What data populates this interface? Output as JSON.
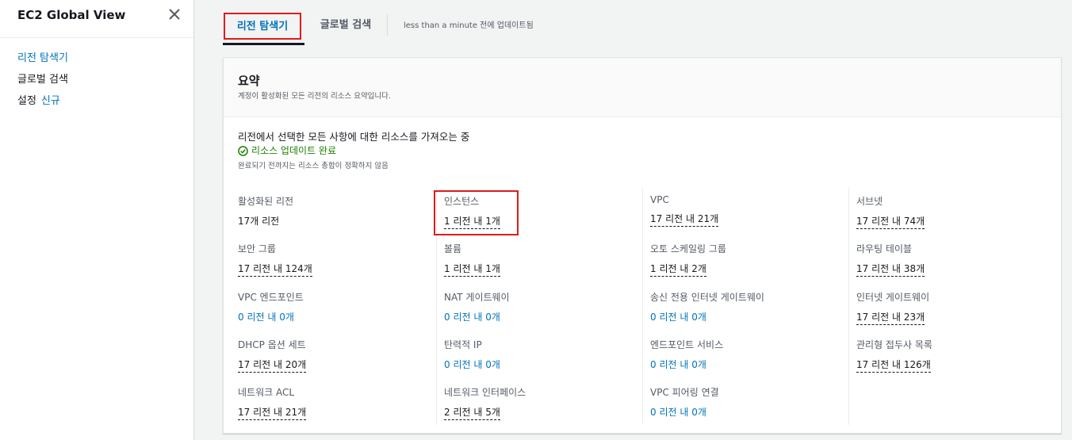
{
  "sidebar": {
    "title": "EC2 Global View",
    "items": [
      {
        "label": "리전 탐색기",
        "active": true
      },
      {
        "label": "글로벌 검색",
        "active": false
      },
      {
        "label": "설정",
        "badge": "신규",
        "active": false
      }
    ]
  },
  "tabs": {
    "region_explorer": "리전 탐색기",
    "global_search": "글로벌 검색",
    "updated": "less than a minute 전에 업데이트됨"
  },
  "summary": {
    "title": "요약",
    "subtitle": "계정이 활성화된 모든 리전의 리소스 요약입니다.",
    "status_fetching": "리전에서 선택한 모든 사항에 대한 리소스를 가져오는 중",
    "status_complete": "리소스 업데이트 완료",
    "status_note": "완료되기 전까지는 리소스 총합이 정확하지 않음",
    "columns": [
      [
        {
          "label": "활성화된 리전",
          "value": "17개 리전",
          "style": "plain"
        },
        {
          "label": "보안 그룹",
          "value": "17 리전 내 124개",
          "style": "dashed"
        },
        {
          "label": "VPC 엔드포인트",
          "value": "0 리전 내 0개",
          "style": "link"
        },
        {
          "label": "DHCP 옵션 세트",
          "value": "17 리전 내 20개",
          "style": "dashed"
        },
        {
          "label": "네트워크 ACL",
          "value": "17 리전 내 21개",
          "style": "dashed"
        }
      ],
      [
        {
          "label": "인스턴스",
          "value": "1 리전 내 1개",
          "style": "dashed"
        },
        {
          "label": "볼륨",
          "value": "1 리전 내 1개",
          "style": "dashed"
        },
        {
          "label": "NAT 게이트웨이",
          "value": "0 리전 내 0개",
          "style": "link"
        },
        {
          "label": "탄력적 IP",
          "value": "0 리전 내 0개",
          "style": "link"
        },
        {
          "label": "네트워크 인터페이스",
          "value": "2 리전 내 5개",
          "style": "dashed"
        }
      ],
      [
        {
          "label": "VPC",
          "value": "17 리전 내 21개",
          "style": "dashed"
        },
        {
          "label": "오토 스케일링 그룹",
          "value": "1 리전 내 2개",
          "style": "dashed"
        },
        {
          "label": "송신 전용 인터넷 게이트웨이",
          "value": "0 리전 내 0개",
          "style": "link"
        },
        {
          "label": "엔드포인트 서비스",
          "value": "0 리전 내 0개",
          "style": "link"
        },
        {
          "label": "VPC 피어링 연결",
          "value": "0 리전 내 0개",
          "style": "link"
        }
      ],
      [
        {
          "label": "서브넷",
          "value": "17 리전 내 74개",
          "style": "dashed"
        },
        {
          "label": "라우팅 테이블",
          "value": "17 리전 내 38개",
          "style": "dashed"
        },
        {
          "label": "인터넷 게이트웨이",
          "value": "17 리전 내 23개",
          "style": "dashed"
        },
        {
          "label": "관리형 접두사 목록",
          "value": "17 리전 내 126개",
          "style": "dashed"
        }
      ]
    ]
  },
  "colors": {
    "link": "#0073bb",
    "success": "#1d8102",
    "highlight": "#e01b1b"
  }
}
